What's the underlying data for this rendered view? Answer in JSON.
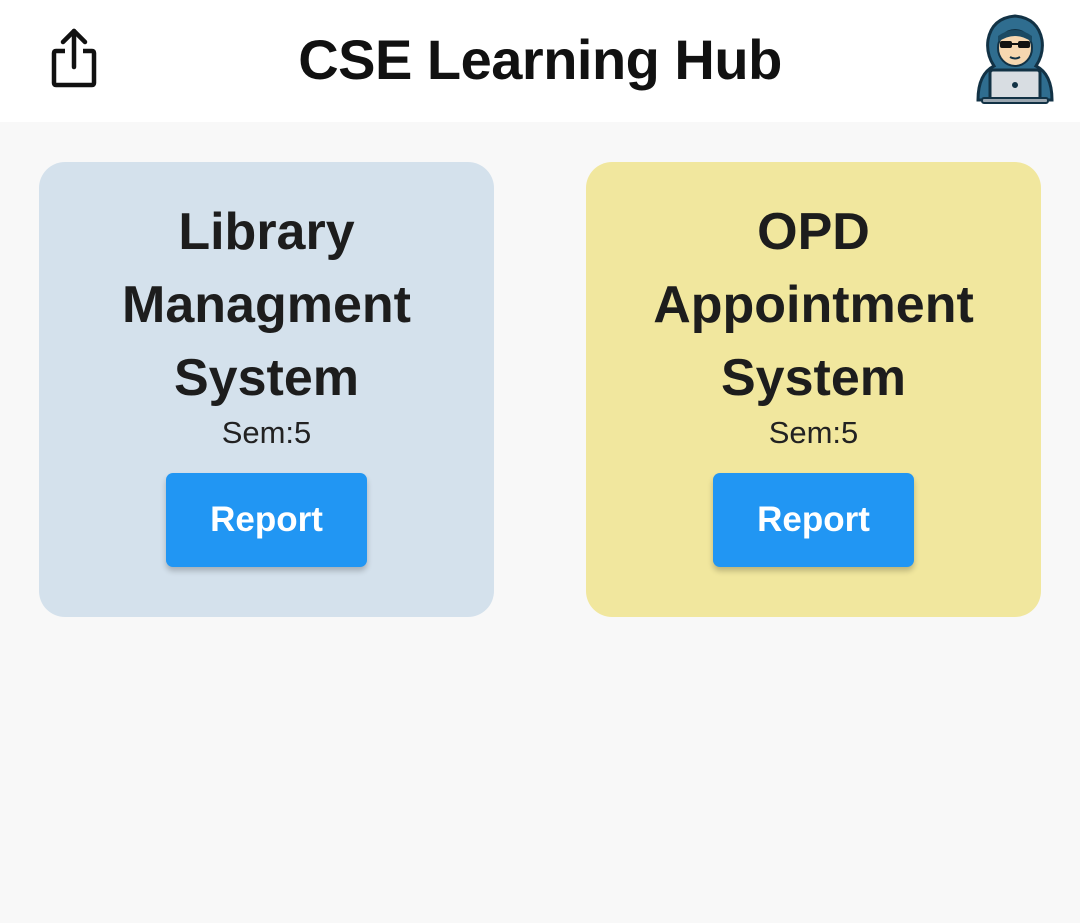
{
  "app_bar": {
    "title": "CSE Learning Hub",
    "share_icon": "share-icon",
    "avatar_icon": "hacker-avatar-icon",
    "background": "#ffffff"
  },
  "page": {
    "background": "#f8f8f8"
  },
  "projects": [
    {
      "title": "Library\nManagment\nSystem",
      "semester": "Sem:5",
      "button_label": "Report",
      "card_color": "#d4e1ec"
    },
    {
      "title": "OPD\nAppointment\nSystem",
      "semester": "Sem:5",
      "button_label": "Report",
      "card_color": "#f1e79e"
    }
  ],
  "colors": {
    "accent": "#2196f3",
    "title_text": "#111111"
  }
}
